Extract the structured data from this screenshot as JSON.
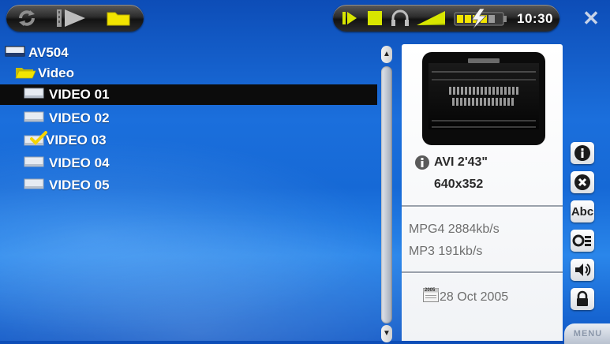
{
  "topbar": {
    "icons_left": [
      "sync-icon",
      "video-play-icon",
      "folder-icon"
    ],
    "icons_right": [
      "play-status-icon",
      "stop-status-icon",
      "headphones-icon",
      "volume-level-icon",
      "battery-charging-icon"
    ],
    "clock": "10:30",
    "close_glyph": "✕"
  },
  "tree": {
    "root": {
      "label": "AV504",
      "icon": "drive-icon"
    },
    "folder": {
      "label": "Video",
      "icon": "open-folder-icon"
    },
    "items": [
      {
        "label": "VIDEO 01",
        "icon": "video-file-icon",
        "selected": true,
        "checked": false
      },
      {
        "label": "VIDEO 02",
        "icon": "video-file-icon",
        "selected": false,
        "checked": false
      },
      {
        "label": "VIDEO 03",
        "icon": "video-file-icon",
        "selected": false,
        "checked": true
      },
      {
        "label": "VIDEO 04",
        "icon": "video-file-icon",
        "selected": false,
        "checked": false
      },
      {
        "label": "VIDEO 05",
        "icon": "video-file-icon",
        "selected": false,
        "checked": false
      }
    ]
  },
  "info": {
    "format": "AVI 2'43\"",
    "resolution": "640x352",
    "video_codec": "MPG4 2884kb/s",
    "audio_codec": "MP3 191kb/s",
    "date_icon_text": "2005",
    "date": "28 Oct 2005"
  },
  "side_buttons": [
    {
      "name": "info-button",
      "icon": "info-icon",
      "glyph": "i"
    },
    {
      "name": "delete-button",
      "icon": "delete-icon",
      "glyph": "✕"
    },
    {
      "name": "rename-button",
      "icon": "rename-icon",
      "glyph": "Abc"
    },
    {
      "name": "settings-button",
      "icon": "settings-icon",
      "glyph": "O≡"
    },
    {
      "name": "sound-button",
      "icon": "speaker-icon",
      "glyph": "◀)"
    },
    {
      "name": "lock-button",
      "icon": "lock-icon",
      "glyph": ""
    }
  ],
  "menu": {
    "label": "MENU"
  },
  "colors": {
    "selection": "#0c0c0c",
    "folder": "#f2e400",
    "check": "#f5d400",
    "accent_green": "#d8e600"
  }
}
